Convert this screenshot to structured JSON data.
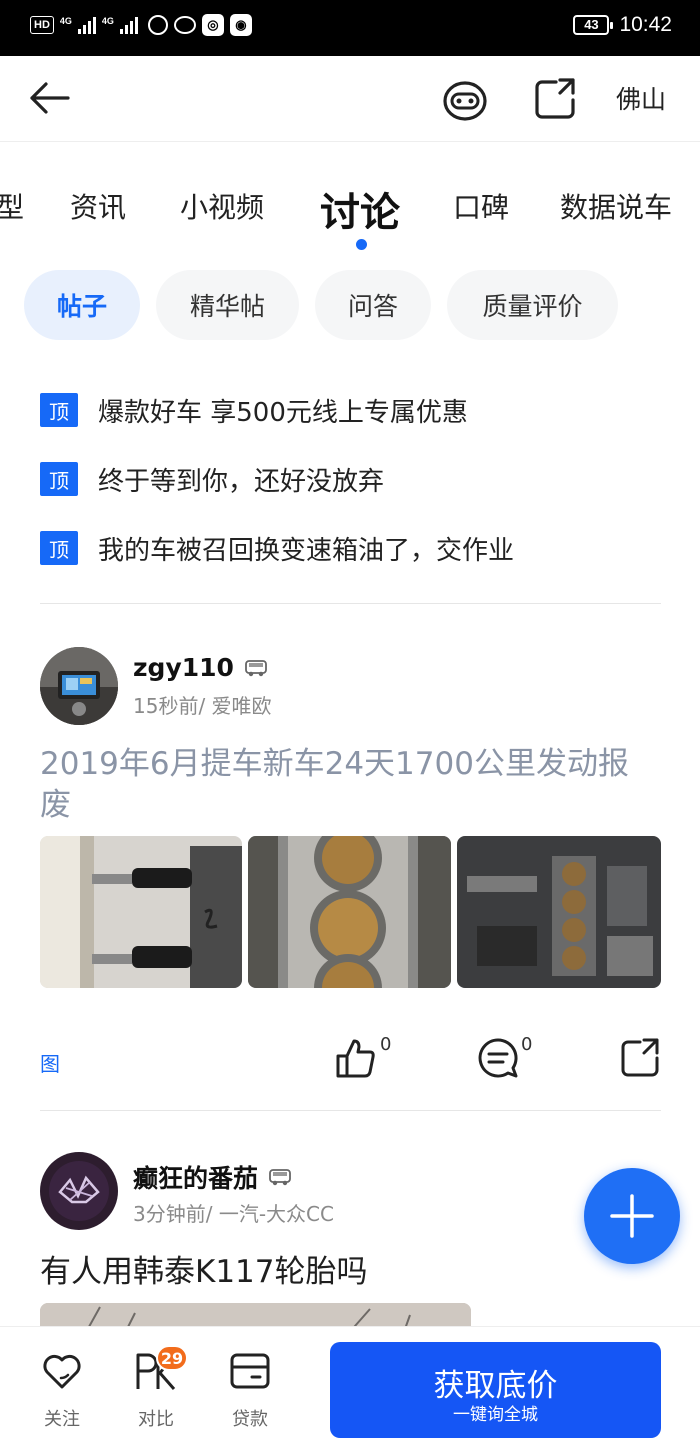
{
  "status_bar": {
    "hd": "HD",
    "net1": "4G",
    "net2": "4G",
    "battery": "43",
    "time": "10:42"
  },
  "header": {
    "city": "佛山"
  },
  "tabs": [
    {
      "label": "型"
    },
    {
      "label": "资讯"
    },
    {
      "label": "小视频"
    },
    {
      "label": "讨论",
      "active": true
    },
    {
      "label": "口碑"
    },
    {
      "label": "数据说车"
    }
  ],
  "filters": [
    {
      "label": "帖子",
      "active": true
    },
    {
      "label": "精华帖"
    },
    {
      "label": "问答"
    },
    {
      "label": "质量评价"
    }
  ],
  "pinned": {
    "badge": "顶",
    "items": [
      {
        "text": "爆款好车 享500元线上专属优惠"
      },
      {
        "text": "终于等到你，还好没放弃"
      },
      {
        "text": "我的车被召回换变速箱油了，交作业"
      }
    ]
  },
  "posts": [
    {
      "username": "zgy110",
      "meta": "15秒前/ 爱唯欧",
      "title": "2019年6月提车新车24天1700公里发动报废",
      "tag": "图",
      "likes": "0",
      "comments": "0"
    },
    {
      "username": "癫狂的番茄",
      "meta": "3分钟前/ 一汽-大众CC",
      "title": "有人用韩泰K117轮胎吗"
    }
  ],
  "bottom_bar": {
    "follow_label": "关注",
    "compare_label": "对比",
    "compare_badge": "29",
    "loan_label": "贷款",
    "cta_main": "获取底价",
    "cta_sub": "一键询全城"
  },
  "colors": {
    "accent": "#1669f7",
    "cta": "#1556f5",
    "badge": "#f26c1c"
  }
}
